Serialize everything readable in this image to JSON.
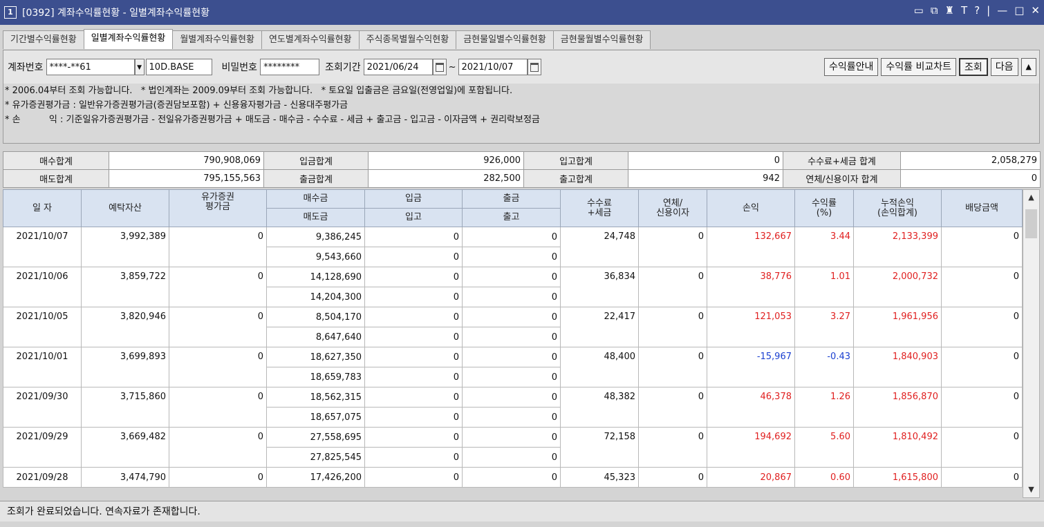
{
  "window": {
    "number": "1",
    "title": "[0392] 계좌수익률현황 - 일별계좌수익률현황"
  },
  "tabs": [
    "기간별수익률현황",
    "일별계좌수익률현황",
    "월별계좌수익률현황",
    "연도별계좌수익률현황",
    "주식종목별월수익현황",
    "금현물일별수익률현황",
    "금현물월별수익률현황"
  ],
  "toolbar": {
    "account_label": "계좌번호",
    "account_value": "****-**61",
    "account_name": "10D.BASE",
    "password_label": "비밀번호",
    "password_value": "********",
    "period_label": "조회기간",
    "date_from": "2021/06/24",
    "date_sep": "~",
    "date_to": "2021/10/07",
    "btn_guide": "수익률안내",
    "btn_chart": "수익률 비교차트",
    "btn_query": "조회",
    "btn_next": "다음",
    "btn_collapse": "▲"
  },
  "notes": [
    "* 2006.04부터 조회 가능합니다.   * 법인계좌는 2009.09부터 조회 가능합니다.   * 토요일 입출금은 금요일(전영업일)에 포함됩니다.",
    "* 유가증권평가금 : 일반유가증권평가금(증권담보포함) + 신용융자평가금 - 신용대주평가금",
    "* 손          익 : 기준일유가증권평가금 - 전일유가증권평가금 + 매도금 - 매수금 - 수수료 - 세금 + 출고금 - 입고금 - 이자금액 + 권리락보정금"
  ],
  "summary": [
    [
      {
        "label": "매수합계",
        "value": "790,908,069"
      },
      {
        "label": "입금합계",
        "value": "926,000"
      },
      {
        "label": "입고합계",
        "value": "0"
      },
      {
        "label": "수수료+세금 합계",
        "value": "2,058,279"
      }
    ],
    [
      {
        "label": "매도합계",
        "value": "795,155,563"
      },
      {
        "label": "출금합계",
        "value": "282,500"
      },
      {
        "label": "출고합계",
        "value": "942"
      },
      {
        "label": "연체/신용이자 합계",
        "value": "0"
      }
    ]
  ],
  "columns": {
    "date": "일 자",
    "deposit": "예탁자산",
    "securities": "유가증권\n평가금",
    "buy": "매수금",
    "sell": "매도금",
    "in_money": "입금",
    "in_stock": "입고",
    "out_money": "출금",
    "out_stock": "출고",
    "fee": "수수료\n+세금",
    "interest": "연체/\n신용이자",
    "profit": "손익",
    "rate": "수익률\n(%)",
    "cum": "누적손익\n(손익합계)",
    "dividend": "배당금액"
  },
  "rows": [
    {
      "date": "2021/10/07",
      "deposit": "3,992,389",
      "securities": "0",
      "buy": "9,386,245",
      "sell": "9,543,660",
      "in_money": "0",
      "in_stock": "0",
      "out_money": "0",
      "out_stock": "0",
      "fee": "24,748",
      "interest": "0",
      "profit": "132,667",
      "rate": "3.44",
      "cum": "2,133,399",
      "dividend": "0",
      "sign": "pos"
    },
    {
      "date": "2021/10/06",
      "deposit": "3,859,722",
      "securities": "0",
      "buy": "14,128,690",
      "sell": "14,204,300",
      "in_money": "0",
      "in_stock": "0",
      "out_money": "0",
      "out_stock": "0",
      "fee": "36,834",
      "interest": "0",
      "profit": "38,776",
      "rate": "1.01",
      "cum": "2,000,732",
      "dividend": "0",
      "sign": "pos"
    },
    {
      "date": "2021/10/05",
      "deposit": "3,820,946",
      "securities": "0",
      "buy": "8,504,170",
      "sell": "8,647,640",
      "in_money": "0",
      "in_stock": "0",
      "out_money": "0",
      "out_stock": "0",
      "fee": "22,417",
      "interest": "0",
      "profit": "121,053",
      "rate": "3.27",
      "cum": "1,961,956",
      "dividend": "0",
      "sign": "pos"
    },
    {
      "date": "2021/10/01",
      "deposit": "3,699,893",
      "securities": "0",
      "buy": "18,627,350",
      "sell": "18,659,783",
      "in_money": "0",
      "in_stock": "0",
      "out_money": "0",
      "out_stock": "0",
      "fee": "48,400",
      "interest": "0",
      "profit": "-15,967",
      "rate": "-0.43",
      "cum": "1,840,903",
      "dividend": "0",
      "sign": "neg"
    },
    {
      "date": "2021/09/30",
      "deposit": "3,715,860",
      "securities": "0",
      "buy": "18,562,315",
      "sell": "18,657,075",
      "in_money": "0",
      "in_stock": "0",
      "out_money": "0",
      "out_stock": "0",
      "fee": "48,382",
      "interest": "0",
      "profit": "46,378",
      "rate": "1.26",
      "cum": "1,856,870",
      "dividend": "0",
      "sign": "pos"
    },
    {
      "date": "2021/09/29",
      "deposit": "3,669,482",
      "securities": "0",
      "buy": "27,558,695",
      "sell": "27,825,545",
      "in_money": "0",
      "in_stock": "0",
      "out_money": "0",
      "out_stock": "0",
      "fee": "72,158",
      "interest": "0",
      "profit": "194,692",
      "rate": "5.60",
      "cum": "1,810,492",
      "dividend": "0",
      "sign": "pos"
    },
    {
      "date": "2021/09/28",
      "deposit": "3,474,790",
      "securities": "0",
      "buy": "17,426,200",
      "sell": "",
      "in_money": "0",
      "in_stock": "",
      "out_money": "0",
      "out_stock": "",
      "fee": "45,323",
      "interest": "0",
      "profit": "20,867",
      "rate": "0.60",
      "cum": "1,615,800",
      "dividend": "0",
      "sign": "pos"
    }
  ],
  "status": "조회가 완료되었습니다. 연속자료가 존재합니다.",
  "colors": {
    "title_bar": "#3c4f8f",
    "positive": "#e02020",
    "negative": "#1a3fd0",
    "header_bg": "#d9e3f1"
  }
}
